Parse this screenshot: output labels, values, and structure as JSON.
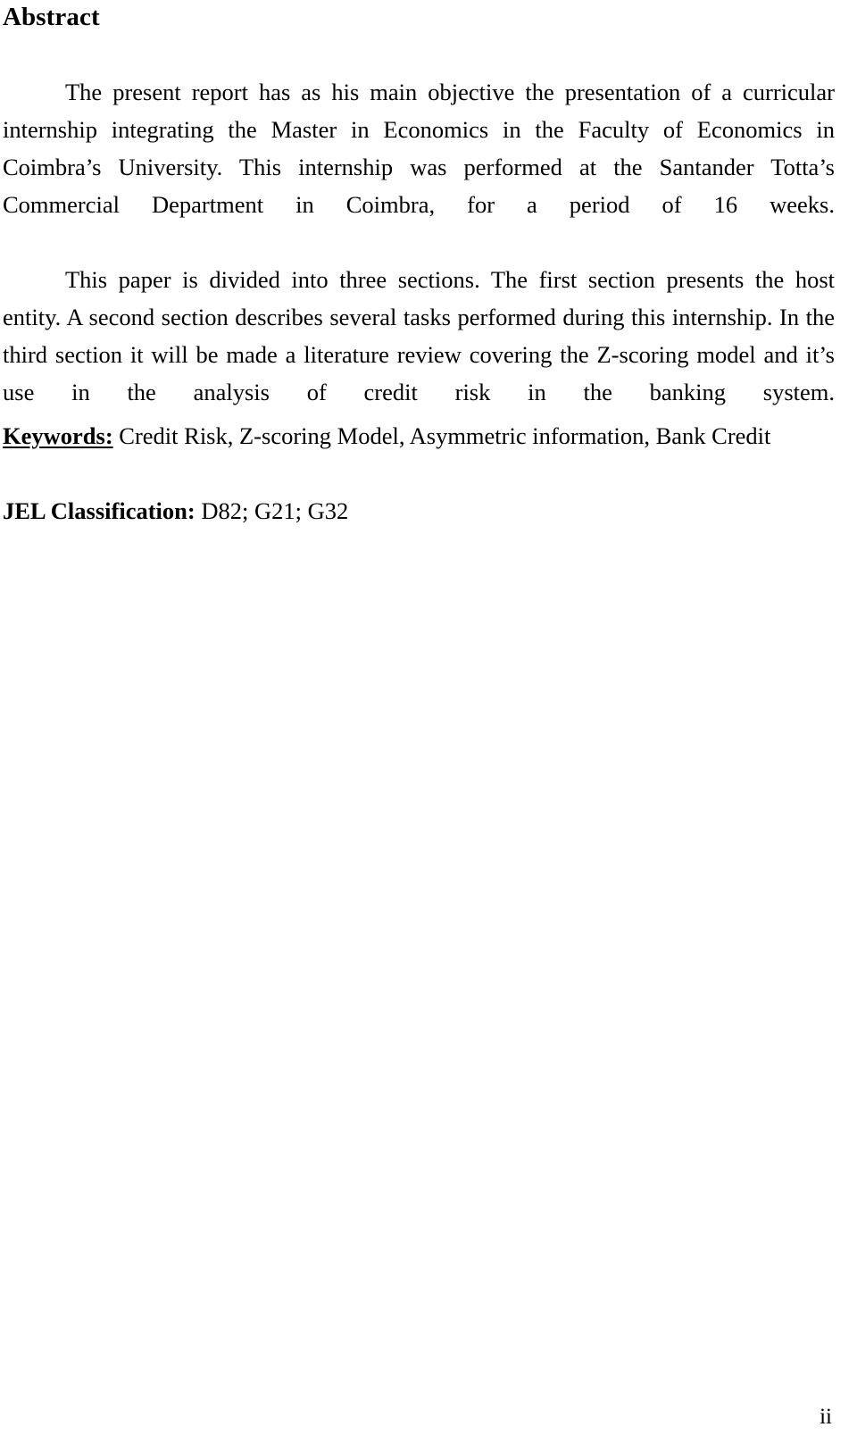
{
  "document": {
    "page_color": "#ffffff",
    "text_color": "#000000",
    "heading": "Abstract",
    "paragraphs": [
      "The present report has as his main objective the presentation of a curricular internship integrating the Master in Economics in the Faculty of Economics in Coimbra’s University. This internship was performed at the Santander Totta’s Commercial Department in Coimbra, for a period of 16 weeks.",
      "This paper is divided into three sections. The first section presents the host entity. A second section describes several tasks performed during this internship. In the third section it will be made a literature review covering the Z-scoring model and it’s use in the analysis of credit risk in the banking system."
    ],
    "keywords": {
      "label": "Keywords:",
      "value": " Credit Risk, Z-scoring Model, Asymmetric information, Bank Credit"
    },
    "jel": {
      "label": "JEL Classification:",
      "value": " D82; G21; G32"
    },
    "footer": {
      "page_number": "ii"
    }
  }
}
